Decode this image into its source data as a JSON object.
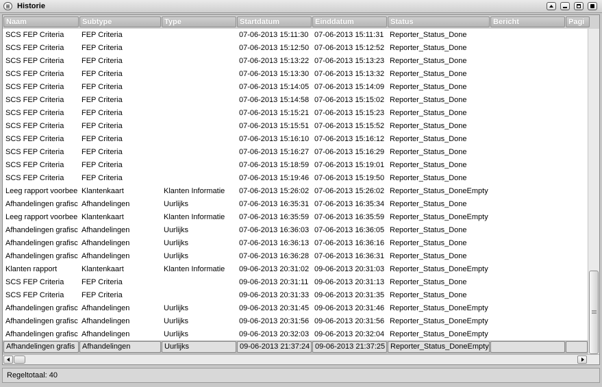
{
  "window": {
    "title": "Historie",
    "system_menu_icon": "menu-icon",
    "buttons": [
      "roll-up-icon",
      "minimize-icon",
      "maximize-icon",
      "close-icon"
    ]
  },
  "columns": [
    "Naam",
    "Subtype",
    "Type",
    "Startdatum",
    "Einddatum",
    "Status",
    "Bericht",
    "Pagi"
  ],
  "rows": [
    [
      "SCS FEP Criteria",
      "FEP Criteria",
      "",
      "07-06-2013 15:11:30",
      "07-06-2013 15:11:31",
      "Reporter_Status_Done",
      ""
    ],
    [
      "SCS FEP Criteria",
      "FEP Criteria",
      "",
      "07-06-2013 15:12:50",
      "07-06-2013 15:12:52",
      "Reporter_Status_Done",
      ""
    ],
    [
      "SCS FEP Criteria",
      "FEP Criteria",
      "",
      "07-06-2013 15:13:22",
      "07-06-2013 15:13:23",
      "Reporter_Status_Done",
      ""
    ],
    [
      "SCS FEP Criteria",
      "FEP Criteria",
      "",
      "07-06-2013 15:13:30",
      "07-06-2013 15:13:32",
      "Reporter_Status_Done",
      ""
    ],
    [
      "SCS FEP Criteria",
      "FEP Criteria",
      "",
      "07-06-2013 15:14:05",
      "07-06-2013 15:14:09",
      "Reporter_Status_Done",
      ""
    ],
    [
      "SCS FEP Criteria",
      "FEP Criteria",
      "",
      "07-06-2013 15:14:58",
      "07-06-2013 15:15:02",
      "Reporter_Status_Done",
      ""
    ],
    [
      "SCS FEP Criteria",
      "FEP Criteria",
      "",
      "07-06-2013 15:15:21",
      "07-06-2013 15:15:23",
      "Reporter_Status_Done",
      ""
    ],
    [
      "SCS FEP Criteria",
      "FEP Criteria",
      "",
      "07-06-2013 15:15:51",
      "07-06-2013 15:15:52",
      "Reporter_Status_Done",
      ""
    ],
    [
      "SCS FEP Criteria",
      "FEP Criteria",
      "",
      "07-06-2013 15:16:10",
      "07-06-2013 15:16:12",
      "Reporter_Status_Done",
      ""
    ],
    [
      "SCS FEP Criteria",
      "FEP Criteria",
      "",
      "07-06-2013 15:16:27",
      "07-06-2013 15:16:29",
      "Reporter_Status_Done",
      ""
    ],
    [
      "SCS FEP Criteria",
      "FEP Criteria",
      "",
      "07-06-2013 15:18:59",
      "07-06-2013 15:19:01",
      "Reporter_Status_Done",
      ""
    ],
    [
      "SCS FEP Criteria",
      "FEP Criteria",
      "",
      "07-06-2013 15:19:46",
      "07-06-2013 15:19:50",
      "Reporter_Status_Done",
      ""
    ],
    [
      "Leeg rapport voorbee",
      "Klantenkaart",
      "Klanten Informatie",
      "07-06-2013 15:26:02",
      "07-06-2013 15:26:02",
      "Reporter_Status_DoneEmpty",
      ""
    ],
    [
      "Afhandelingen grafisc",
      "Afhandelingen",
      "Uurlijks",
      "07-06-2013 16:35:31",
      "07-06-2013 16:35:34",
      "Reporter_Status_Done",
      ""
    ],
    [
      "Leeg rapport voorbee",
      "Klantenkaart",
      "Klanten Informatie",
      "07-06-2013 16:35:59",
      "07-06-2013 16:35:59",
      "Reporter_Status_DoneEmpty",
      ""
    ],
    [
      "Afhandelingen grafisc",
      "Afhandelingen",
      "Uurlijks",
      "07-06-2013 16:36:03",
      "07-06-2013 16:36:05",
      "Reporter_Status_Done",
      ""
    ],
    [
      "Afhandelingen grafisc",
      "Afhandelingen",
      "Uurlijks",
      "07-06-2013 16:36:13",
      "07-06-2013 16:36:16",
      "Reporter_Status_Done",
      ""
    ],
    [
      "Afhandelingen grafisc",
      "Afhandelingen",
      "Uurlijks",
      "07-06-2013 16:36:28",
      "07-06-2013 16:36:31",
      "Reporter_Status_Done",
      ""
    ],
    [
      "Klanten rapport",
      "Klantenkaart",
      "Klanten Informatie",
      "09-06-2013 20:31:02",
      "09-06-2013 20:31:03",
      "Reporter_Status_DoneEmpty",
      ""
    ],
    [
      "SCS FEP Criteria",
      "FEP Criteria",
      "",
      "09-06-2013 20:31:11",
      "09-06-2013 20:31:13",
      "Reporter_Status_Done",
      ""
    ],
    [
      "SCS FEP Criteria",
      "FEP Criteria",
      "",
      "09-06-2013 20:31:33",
      "09-06-2013 20:31:35",
      "Reporter_Status_Done",
      ""
    ],
    [
      "Afhandelingen grafisc",
      "Afhandelingen",
      "Uurlijks",
      "09-06-2013 20:31:45",
      "09-06-2013 20:31:46",
      "Reporter_Status_DoneEmpty",
      ""
    ],
    [
      "Afhandelingen grafisc",
      "Afhandelingen",
      "Uurlijks",
      "09-06-2013 20:31:56",
      "09-06-2013 20:31:56",
      "Reporter_Status_DoneEmpty",
      ""
    ],
    [
      "Afhandelingen grafisc",
      "Afhandelingen",
      "Uurlijks",
      "09-06-2013 20:32:03",
      "09-06-2013 20:32:04",
      "Reporter_Status_DoneEmpty",
      ""
    ]
  ],
  "selected_row": [
    "Afhandelingen grafis",
    "Afhandelingen",
    "Uurlijks",
    "09-06-2013 21:37:24",
    "09-06-2013 21:37:25",
    "Reporter_Status_DoneEmpty",
    ""
  ],
  "status": {
    "row_total": "Regeltotaal: 40"
  }
}
